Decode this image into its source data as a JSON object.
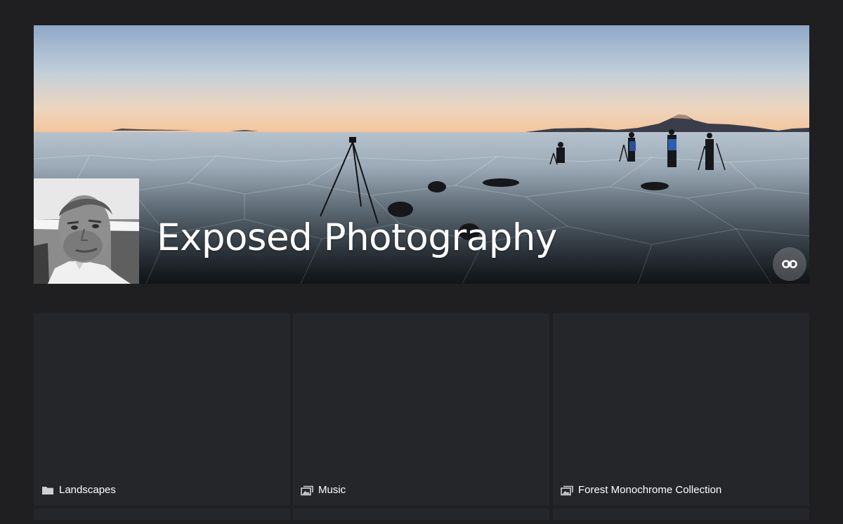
{
  "header": {
    "title": "Exposed Photography"
  },
  "albums": [
    {
      "label": "Landscapes",
      "icon": "folder-icon"
    },
    {
      "label": "Music",
      "icon": "photo-album-icon"
    },
    {
      "label": "Forest Monochrome Collection",
      "icon": "photo-album-icon"
    }
  ],
  "colors": {
    "page_background": "#1f1f21",
    "tile_background": "#25262a",
    "text": "#ffffff",
    "icon": "#cfcfcf"
  }
}
